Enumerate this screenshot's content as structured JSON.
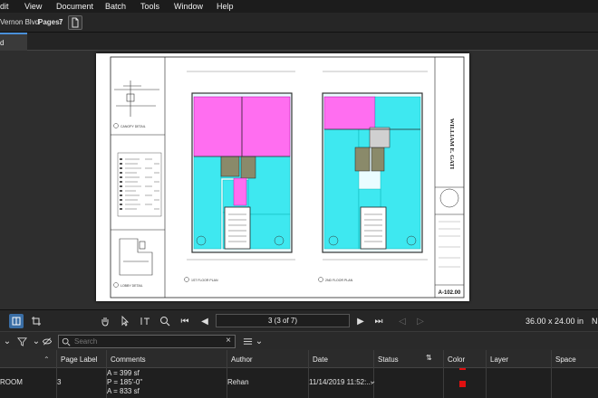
{
  "menu": [
    "dit",
    "View",
    "Document",
    "Batch",
    "Tools",
    "Window",
    "Help"
  ],
  "toolbar": {
    "doc_name": "Vernon Blvd",
    "pages_label": "Pages:",
    "pages_value": "7"
  },
  "tab": {
    "label": "d"
  },
  "sheet": {
    "title_block": "WILLIAM E. GATI",
    "sheet_number": "A-102.00",
    "detail_labels": [
      "CANOPY DETAIL",
      "LOBBY DETAIL",
      "1ST FLOOR PLAN",
      "2ND FLOOR PLAN"
    ]
  },
  "nav": {
    "page_text": "3 (3 of 7)",
    "dimensions": "36.00 x 24.00 in",
    "dimensions_cut": "N"
  },
  "search": {
    "placeholder": "Search"
  },
  "table": {
    "headers": [
      "Page Label",
      "Comments",
      "Author",
      "Date",
      "Status",
      "Color",
      "Layer",
      "Space"
    ],
    "row": {
      "subject": "ROOM",
      "page_label": "3",
      "comments": [
        "A = 399 sf",
        "P = 185'-0\"",
        "A = 833 sf"
      ],
      "author": "Rehan",
      "date": "11/14/2019 11:52:..."
    }
  },
  "colors": {
    "accent": "#4a90d9",
    "markup_magenta": "#ff6ef0",
    "markup_cyan": "#3ee8f0",
    "row_color": "#e01010"
  }
}
